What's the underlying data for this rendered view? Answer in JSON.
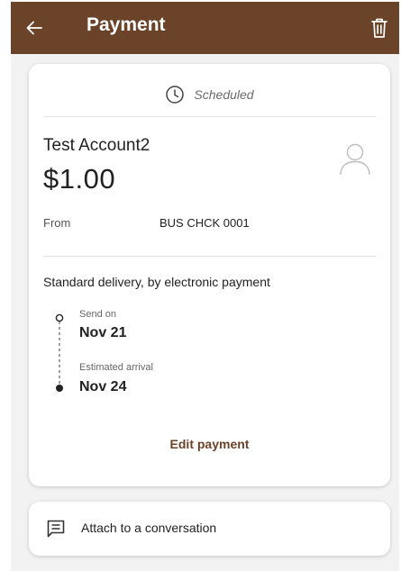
{
  "app_bar": {
    "title": "Payment",
    "back_icon": "arrow-left-icon",
    "delete_icon": "trash-icon",
    "color": "#6b4328"
  },
  "payment": {
    "status": "Scheduled",
    "status_icon": "clock-icon",
    "payee": "Test Account2",
    "amount": "$1.00",
    "avatar_icon": "person-icon",
    "from_label": "From",
    "from_value": "BUS CHCK 0001",
    "delivery_method": "Standard delivery, by electronic payment",
    "timeline": {
      "send_label": "Send on",
      "send_date": "Nov 21",
      "arrival_label": "Estimated arrival",
      "arrival_date": "Nov 24"
    },
    "edit_label": "Edit payment"
  },
  "attach": {
    "label": "Attach to a conversation",
    "icon": "chat-icon"
  }
}
